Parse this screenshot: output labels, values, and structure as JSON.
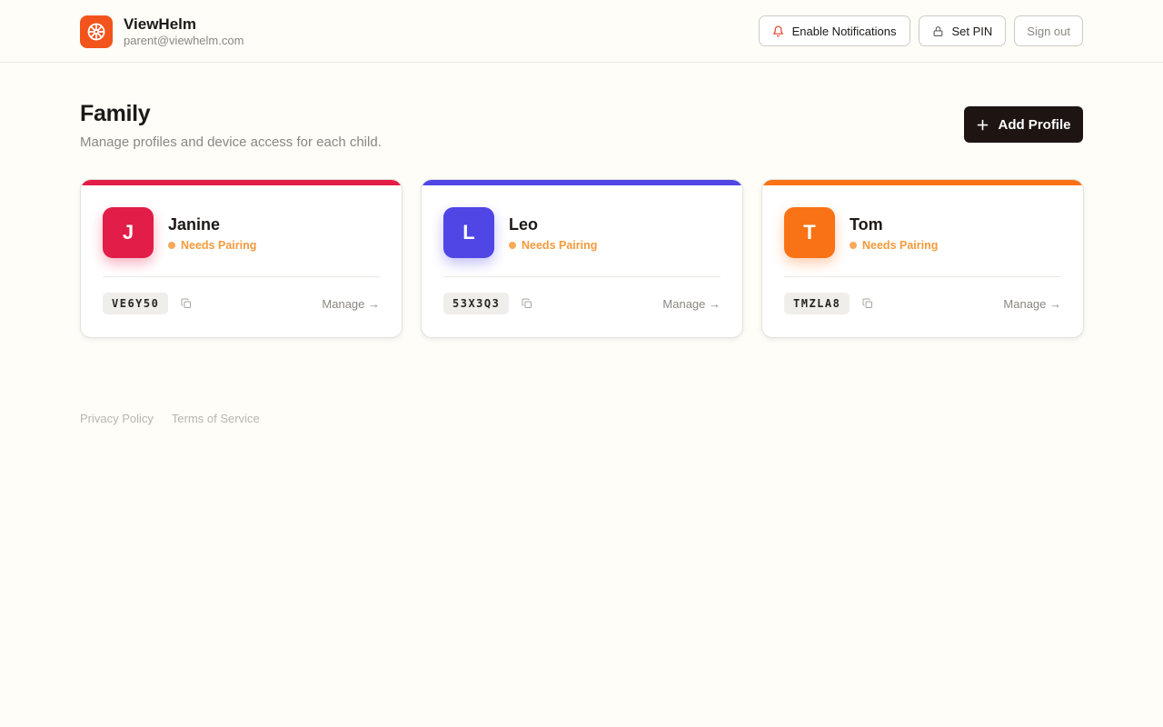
{
  "brand": {
    "name": "ViewHelm",
    "email": "parent@viewhelm.com",
    "color": "#f2541b"
  },
  "header_actions": {
    "notifications": "Enable Notifications",
    "set_pin": "Set PIN",
    "sign_out": "Sign out"
  },
  "page": {
    "title": "Family",
    "subtitle": "Manage profiles and device access for each child.",
    "add_profile": "Add Profile"
  },
  "profiles": [
    {
      "initial": "J",
      "name": "Janine",
      "status": "Needs Pairing",
      "code": "VE6Y50",
      "manage": "Manage →",
      "color": "#e11d48"
    },
    {
      "initial": "L",
      "name": "Leo",
      "status": "Needs Pairing",
      "code": "53X3Q3",
      "manage": "Manage →",
      "color": "#4f46e5"
    },
    {
      "initial": "T",
      "name": "Tom",
      "status": "Needs Pairing",
      "code": "TMZLA8",
      "manage": "Manage →",
      "color": "#f97316"
    }
  ],
  "footer": {
    "privacy": "Privacy Policy",
    "terms": "Terms of Service"
  },
  "icons": {
    "logo": "ship-wheel-icon",
    "notifications": "bell-icon",
    "set_pin": "lock-icon",
    "add": "plus-icon",
    "copy": "copy-icon"
  }
}
